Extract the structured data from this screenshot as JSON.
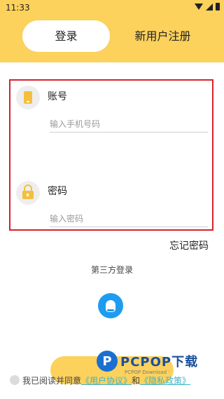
{
  "status_bar": {
    "time": "11:33"
  },
  "tabs": [
    {
      "label": "登录"
    },
    {
      "label": "新用户注册"
    }
  ],
  "account": {
    "label": "账号",
    "placeholder": "输入手机号码"
  },
  "password": {
    "label": "密码",
    "placeholder": "输入密码"
  },
  "forgot_label": "忘记密码",
  "third_party": {
    "title": "第三方登录",
    "provider_icon": "qq-icon"
  },
  "agreement": {
    "prefix": "我已阅读并同意",
    "user_agreement": "《用户协议》",
    "and": "和",
    "privacy_policy": "《隐私政策》"
  },
  "watermark": {
    "logo": "P",
    "text": "PCPOP下载",
    "sub": "PCPOP Download"
  },
  "colors": {
    "accent": "#FCD15C",
    "icon": "#F5BF3E",
    "link": "#3FB3C9",
    "qq": "#1E9CF0",
    "highlight_border": "#d7232b"
  }
}
